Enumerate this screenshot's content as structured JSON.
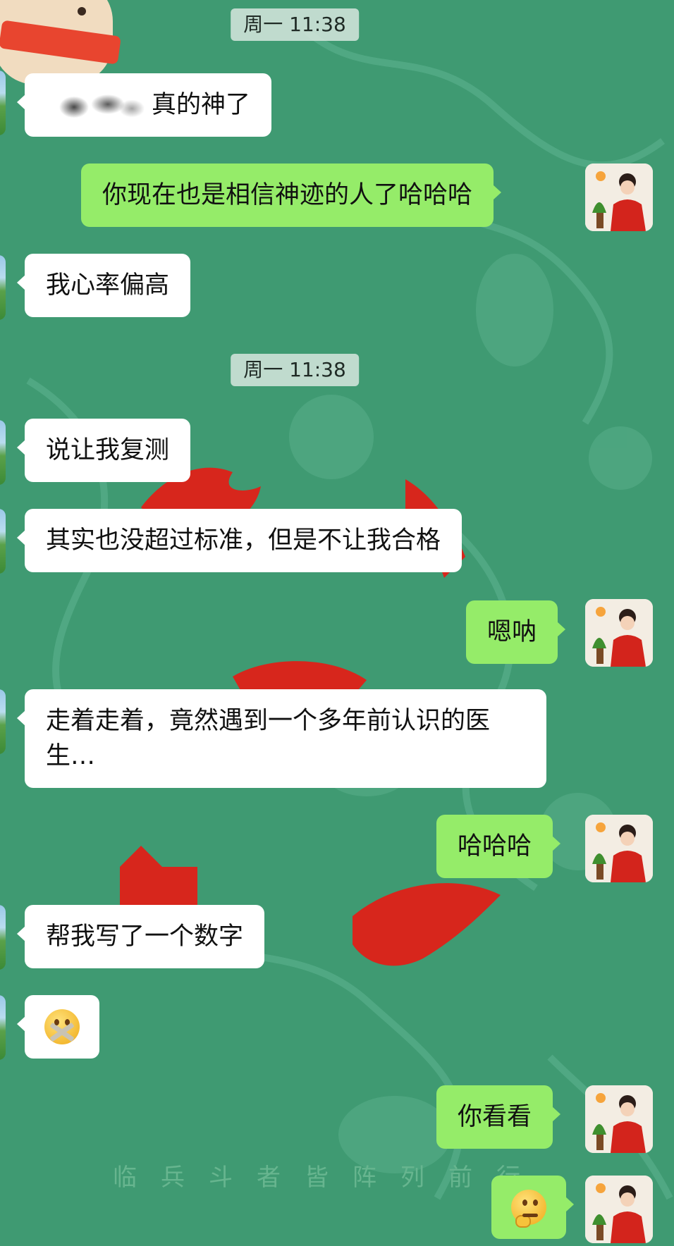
{
  "chat": {
    "timestamps": [
      "周一 11:38",
      "周一 11:38"
    ],
    "messages": [
      {
        "side": "in",
        "text": "真的神了",
        "redacted_prefix": true
      },
      {
        "side": "out",
        "text": "你现在也是相信神迹的人了哈哈哈"
      },
      {
        "side": "in",
        "text": "我心率偏高"
      },
      {
        "side": "in",
        "text": "说让我复测"
      },
      {
        "side": "in",
        "text": "其实也没超过标准，但是不让我合格"
      },
      {
        "side": "out",
        "text": "嗯呐"
      },
      {
        "side": "in",
        "text": "走着走着，竟然遇到一个多年前认识的医生…"
      },
      {
        "side": "out",
        "text": "哈哈哈"
      },
      {
        "side": "in",
        "text": "帮我写了一个数字"
      },
      {
        "side": "in",
        "emoji": "zipped-mouth-emoji"
      },
      {
        "side": "out",
        "text": "你看看"
      },
      {
        "side": "out",
        "emoji": "thinking-emoji"
      }
    ]
  },
  "wallpaper": {
    "caption": "临兵斗者皆阵列前行"
  },
  "colors": {
    "background": "#3f9a72",
    "incoming_bubble": "#ffffff",
    "outgoing_bubble": "#95ec69",
    "timestamp_pill": "#d7e6de",
    "wallpaper_red": "#d7261c"
  }
}
